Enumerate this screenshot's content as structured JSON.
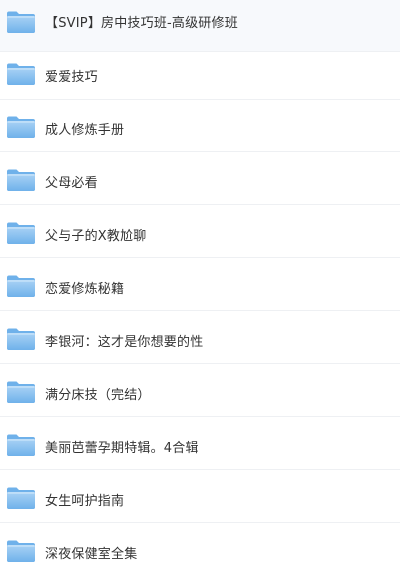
{
  "file_list": {
    "items": [
      {
        "name": "【SVIP】房中技巧班-高级研修班",
        "type": "folder",
        "icon": "folder-icon"
      },
      {
        "name": "爱爱技巧",
        "type": "folder",
        "icon": "folder-icon"
      },
      {
        "name": "成人修炼手册",
        "type": "folder",
        "icon": "folder-icon"
      },
      {
        "name": "父母必看",
        "type": "folder",
        "icon": "folder-icon"
      },
      {
        "name": "父与子的X教尬聊",
        "type": "folder",
        "icon": "folder-icon"
      },
      {
        "name": "恋爱修炼秘籍",
        "type": "folder",
        "icon": "folder-icon"
      },
      {
        "name": "李银河：这才是你想要的性",
        "type": "folder",
        "icon": "folder-icon"
      },
      {
        "name": "满分床技（完结）",
        "type": "folder",
        "icon": "folder-icon"
      },
      {
        "name": "美丽芭蕾孕期特辑。4合辑",
        "type": "folder",
        "icon": "folder-icon"
      },
      {
        "name": "女生呵护指南",
        "type": "folder",
        "icon": "folder-icon"
      },
      {
        "name": "深夜保健室全集",
        "type": "folder",
        "icon": "folder-icon"
      }
    ]
  },
  "colors": {
    "folder_light": "#a9d2f5",
    "folder_dark": "#6fb1ea",
    "text": "#333333",
    "divider": "#eef0f3"
  }
}
